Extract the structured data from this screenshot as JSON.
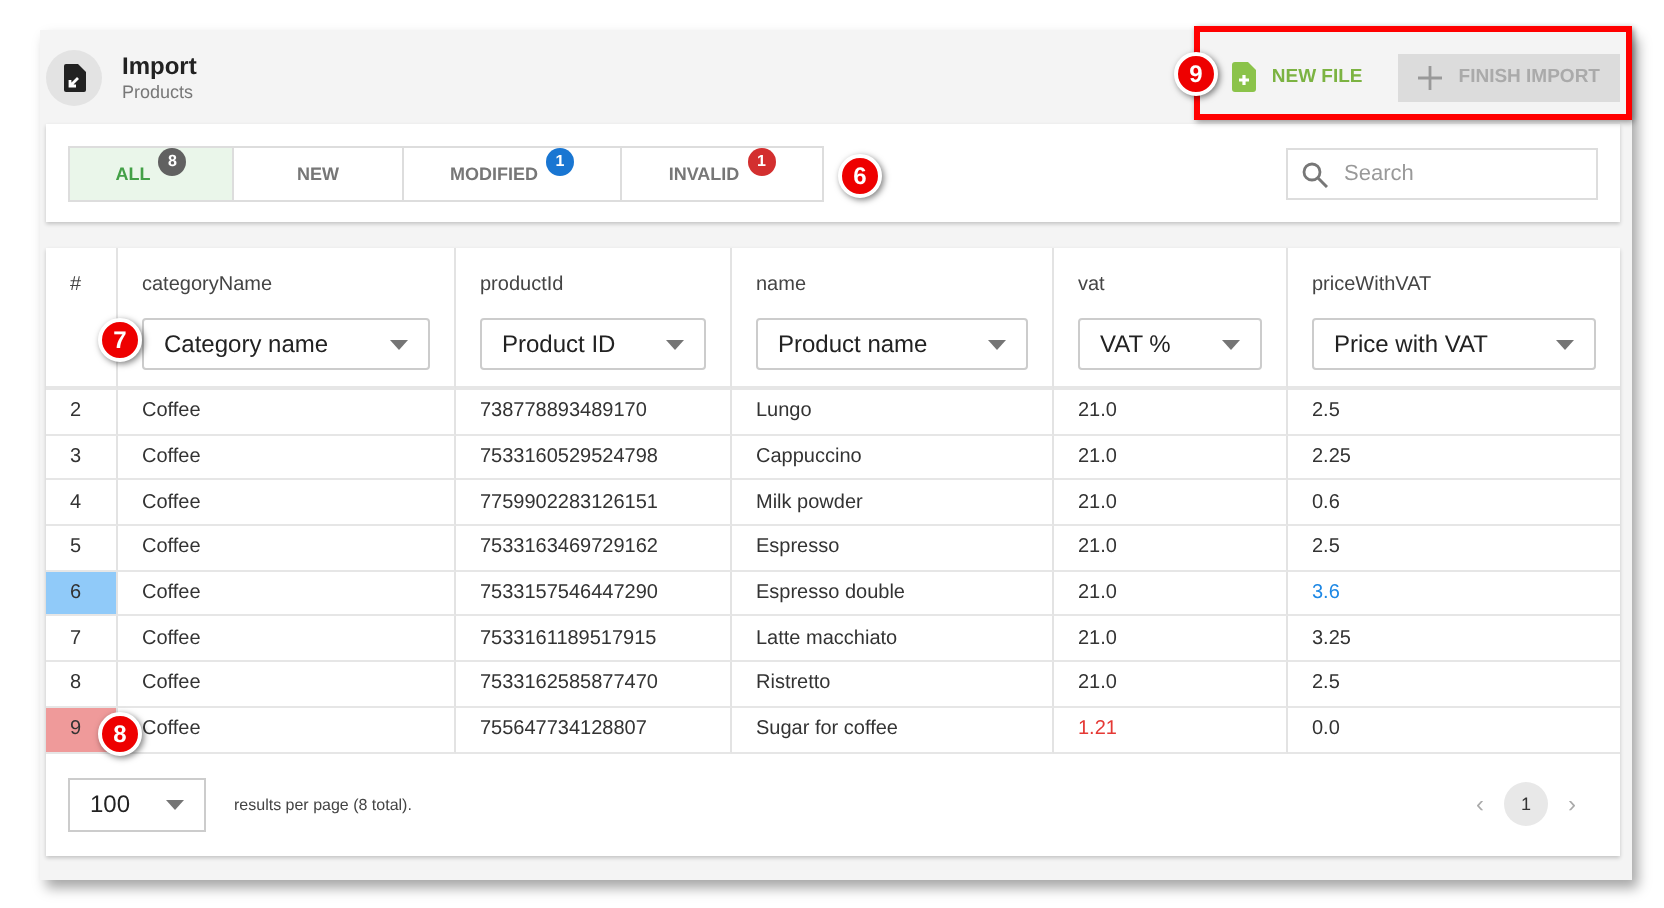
{
  "header": {
    "title": "Import",
    "subtitle": "Products"
  },
  "actions": [
    {
      "kind": "add-file",
      "label": "NEW FILE",
      "disabled": false
    },
    {
      "kind": "plus",
      "label": "FINISH IMPORT",
      "disabled": true
    }
  ],
  "tabs": [
    {
      "label": "ALL",
      "badge": "8",
      "color": "#616161",
      "selected": true
    },
    {
      "label": "NEW",
      "selected": false
    },
    {
      "label": "MODIFIED",
      "badge": "1",
      "color": "#1976d2",
      "selected": false
    },
    {
      "label": "INVALID",
      "badge": "1",
      "color": "#d32f2f",
      "selected": false
    }
  ],
  "search": {
    "placeholder": "Search"
  },
  "table": {
    "columns": [
      {
        "label": "#"
      },
      {
        "label": "categoryName",
        "mapping": "Category name"
      },
      {
        "label": "productId",
        "mapping": "Product ID"
      },
      {
        "label": "name",
        "mapping": "Product name"
      },
      {
        "label": "vat",
        "mapping": "VAT %"
      },
      {
        "label": "priceWithVAT",
        "mapping": "Price with VAT"
      }
    ],
    "rows": [
      {
        "modified": false,
        "invalid": false,
        "cells": [
          {
            "text": "2",
            "flagged": false
          },
          {
            "text": "Coffee",
            "flagged": false
          },
          {
            "text": "738778893489170",
            "flagged": false
          },
          {
            "text": "Lungo",
            "flagged": false
          },
          {
            "text": "21.0",
            "flagged": false
          },
          {
            "text": "2.5",
            "flagged": false
          }
        ]
      },
      {
        "modified": false,
        "invalid": false,
        "cells": [
          {
            "text": "3",
            "flagged": false
          },
          {
            "text": "Coffee",
            "flagged": false
          },
          {
            "text": "7533160529524798",
            "flagged": false
          },
          {
            "text": "Cappuccino",
            "flagged": false
          },
          {
            "text": "21.0",
            "flagged": false
          },
          {
            "text": "2.25",
            "flagged": false
          }
        ]
      },
      {
        "modified": false,
        "invalid": false,
        "cells": [
          {
            "text": "4",
            "flagged": false
          },
          {
            "text": "Coffee",
            "flagged": false
          },
          {
            "text": "7759902283126151",
            "flagged": false
          },
          {
            "text": "Milk powder",
            "flagged": false
          },
          {
            "text": "21.0",
            "flagged": false
          },
          {
            "text": "0.6",
            "flagged": false
          }
        ]
      },
      {
        "modified": false,
        "invalid": false,
        "cells": [
          {
            "text": "5",
            "flagged": false
          },
          {
            "text": "Coffee",
            "flagged": false
          },
          {
            "text": "7533163469729162",
            "flagged": false
          },
          {
            "text": "Espresso",
            "flagged": false
          },
          {
            "text": "21.0",
            "flagged": false
          },
          {
            "text": "2.5",
            "flagged": false
          }
        ]
      },
      {
        "modified": true,
        "invalid": false,
        "cells": [
          {
            "text": "6",
            "flagged": false
          },
          {
            "text": "Coffee",
            "flagged": false
          },
          {
            "text": "7533157546447290",
            "flagged": false
          },
          {
            "text": "Espresso double",
            "flagged": false
          },
          {
            "text": "21.0",
            "flagged": false
          },
          {
            "text": "3.6",
            "flagged": true
          }
        ]
      },
      {
        "modified": false,
        "invalid": false,
        "cells": [
          {
            "text": "7",
            "flagged": false
          },
          {
            "text": "Coffee",
            "flagged": false
          },
          {
            "text": "7533161189517915",
            "flagged": false
          },
          {
            "text": "Latte macchiato",
            "flagged": false
          },
          {
            "text": "21.0",
            "flagged": false
          },
          {
            "text": "3.25",
            "flagged": false
          }
        ]
      },
      {
        "modified": false,
        "invalid": false,
        "cells": [
          {
            "text": "8",
            "flagged": false
          },
          {
            "text": "Coffee",
            "flagged": false
          },
          {
            "text": "7533162585877470",
            "flagged": false
          },
          {
            "text": "Ristretto",
            "flagged": false
          },
          {
            "text": "21.0",
            "flagged": false
          },
          {
            "text": "2.5",
            "flagged": false
          }
        ]
      },
      {
        "modified": false,
        "invalid": true,
        "cells": [
          {
            "text": "9",
            "flagged": false
          },
          {
            "text": "Coffee",
            "flagged": false
          },
          {
            "text": "755647734128807",
            "flagged": false
          },
          {
            "text": "Sugar for coffee",
            "flagged": false
          },
          {
            "text": "1.21",
            "flagged": true
          },
          {
            "text": "0.0",
            "flagged": false
          }
        ]
      }
    ]
  },
  "footer": {
    "page_size": "100",
    "summary": "results per page (8 total).",
    "previous": "‹",
    "next": "›",
    "pages": [
      {
        "label": "1",
        "selected": true
      }
    ]
  },
  "callouts": [
    {
      "label": "6"
    },
    {
      "label": "7"
    },
    {
      "label": "8"
    },
    {
      "label": "9",
      "framed": true
    }
  ]
}
